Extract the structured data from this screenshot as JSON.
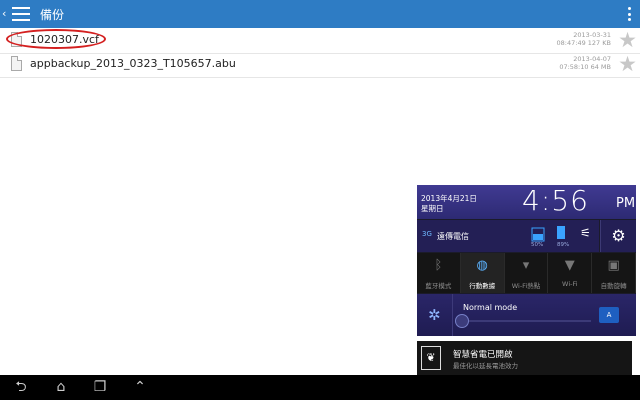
{
  "header": {
    "title": "備份"
  },
  "files": [
    {
      "name": "1020307.vcf",
      "date": "2013-03-31",
      "time_size": "08:47:49 127 KB"
    },
    {
      "name": "appbackup_2013_0323_T105657.abu",
      "date": "2013-04-07",
      "time_size": "07:58:10 64 MB"
    }
  ],
  "panel": {
    "date": "2013年4月21日",
    "weekday": "星期日",
    "time": "4:56",
    "ampm": "PM",
    "signal": "3G",
    "carrier": "遠傳電信",
    "battery1": "50%",
    "battery2": "89%",
    "toggles": [
      {
        "label": "藍牙模式",
        "icon": "bluetooth-icon"
      },
      {
        "label": "行動數據",
        "icon": "mobile-data-icon"
      },
      {
        "label": "Wi-Fi熱點",
        "icon": "hotspot-icon"
      },
      {
        "label": "Wi-Fi",
        "icon": "wifi-icon"
      },
      {
        "label": "自動旋轉",
        "icon": "auto-rotate-icon"
      }
    ],
    "mode_label": "Normal mode"
  },
  "notification": {
    "title": "智慧省電已開啟",
    "subtitle": "最佳化以延長電池效力"
  },
  "colors": {
    "accent": "#2e7cc4",
    "highlight": "#d42020"
  }
}
